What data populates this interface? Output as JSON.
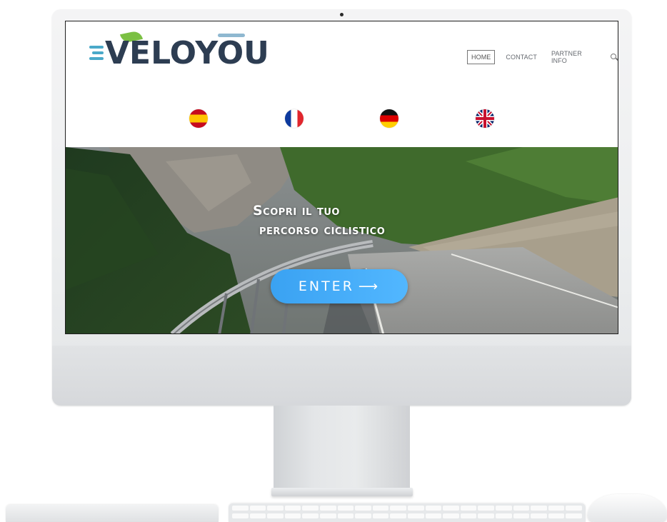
{
  "header": {
    "logo_text": "VELOYOU",
    "nav": [
      {
        "label": "HOME",
        "active": true
      },
      {
        "label": "CONTACT",
        "active": false
      },
      {
        "label": "PARTNER INFO",
        "active": false
      }
    ]
  },
  "languages": [
    {
      "icon": "spain-flag-icon"
    },
    {
      "icon": "france-flag-icon"
    },
    {
      "icon": "germany-flag-icon"
    },
    {
      "icon": "uk-flag-icon"
    }
  ],
  "hero": {
    "title_line1": "Scopri il tuo",
    "title_line2": "percorso ciclistico",
    "enter_label": "ENTER",
    "enter_arrow": "⟶"
  },
  "colors": {
    "logo_dark": "#2d3d52",
    "logo_accent": "#4aa9c9",
    "leaf": "#7bc043",
    "enter_button": "#3aa2f2"
  }
}
